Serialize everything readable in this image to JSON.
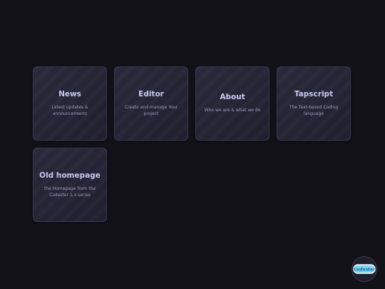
{
  "cards": [
    {
      "title": "News",
      "description": "Latest updates & announcements"
    },
    {
      "title": "Editor",
      "description": "Create and manage Your project"
    },
    {
      "title": "About",
      "description": "Who we are & what we do"
    },
    {
      "title": "Tapscript",
      "description": "The Text-based Coding language"
    },
    {
      "title": "Old homepage",
      "description": "the Homepage from the Codester 1.x series"
    }
  ],
  "logo": {
    "icon": "codester-logo-icon",
    "text": "Codester",
    "colors": {
      "fill": "#7dd3f2",
      "outline": "#ffffff",
      "text": "#1b6f9a"
    }
  }
}
